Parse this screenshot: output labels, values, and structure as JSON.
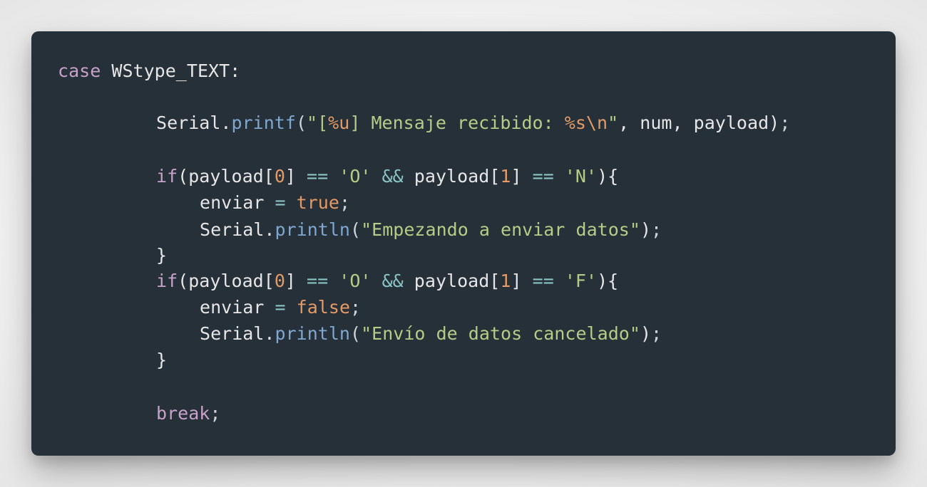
{
  "theme": {
    "background": "#263038",
    "page_background": "#f1f1f1",
    "colors": {
      "plain": "#e6e6e6",
      "keyword": "#c6a1c9",
      "function": "#7fa7cf",
      "string": "#b5cc87",
      "format": "#e39a66",
      "number": "#e39a66",
      "operator": "#8ac4c4",
      "boolean": "#e39a66",
      "punctuation": "#cfd4d8"
    }
  },
  "code": {
    "lines": [
      {
        "indent": 0,
        "tokens": [
          {
            "t": "case",
            "k": "keyword"
          },
          {
            "t": " WStype_TEXT:",
            "k": "plain"
          }
        ]
      },
      {
        "indent": 0,
        "tokens": []
      },
      {
        "indent": 2,
        "tokens": [
          {
            "t": "Serial.",
            "k": "plain"
          },
          {
            "t": "printf",
            "k": "function"
          },
          {
            "t": "(",
            "k": "punctuation"
          },
          {
            "t": "\"",
            "k": "string"
          },
          {
            "t": "[",
            "k": "string"
          },
          {
            "t": "%u",
            "k": "format"
          },
          {
            "t": "] Mensaje recibido: ",
            "k": "string"
          },
          {
            "t": "%s\\n",
            "k": "format"
          },
          {
            "t": "\"",
            "k": "string"
          },
          {
            "t": ", num, payload)",
            "k": "plain"
          },
          {
            "t": ";",
            "k": "punctuation"
          }
        ]
      },
      {
        "indent": 0,
        "tokens": []
      },
      {
        "indent": 2,
        "tokens": [
          {
            "t": "if",
            "k": "keyword"
          },
          {
            "t": "(payload[",
            "k": "plain"
          },
          {
            "t": "0",
            "k": "number"
          },
          {
            "t": "] ",
            "k": "plain"
          },
          {
            "t": "==",
            "k": "operator"
          },
          {
            "t": " ",
            "k": "plain"
          },
          {
            "t": "'O'",
            "k": "string"
          },
          {
            "t": " ",
            "k": "plain"
          },
          {
            "t": "&&",
            "k": "operator"
          },
          {
            "t": " payload[",
            "k": "plain"
          },
          {
            "t": "1",
            "k": "number"
          },
          {
            "t": "] ",
            "k": "plain"
          },
          {
            "t": "==",
            "k": "operator"
          },
          {
            "t": " ",
            "k": "plain"
          },
          {
            "t": "'N'",
            "k": "string"
          },
          {
            "t": "){",
            "k": "plain"
          }
        ]
      },
      {
        "indent": 3,
        "tokens": [
          {
            "t": "enviar ",
            "k": "plain"
          },
          {
            "t": "=",
            "k": "operator"
          },
          {
            "t": " ",
            "k": "plain"
          },
          {
            "t": "true",
            "k": "boolean"
          },
          {
            "t": ";",
            "k": "punctuation"
          }
        ]
      },
      {
        "indent": 3,
        "tokens": [
          {
            "t": "Serial.",
            "k": "plain"
          },
          {
            "t": "println",
            "k": "function"
          },
          {
            "t": "(",
            "k": "punctuation"
          },
          {
            "t": "\"Empezando a enviar datos\"",
            "k": "string"
          },
          {
            "t": ")",
            "k": "plain"
          },
          {
            "t": ";",
            "k": "punctuation"
          }
        ]
      },
      {
        "indent": 2,
        "tokens": [
          {
            "t": "}",
            "k": "plain"
          }
        ]
      },
      {
        "indent": 2,
        "tokens": [
          {
            "t": "if",
            "k": "keyword"
          },
          {
            "t": "(payload[",
            "k": "plain"
          },
          {
            "t": "0",
            "k": "number"
          },
          {
            "t": "] ",
            "k": "plain"
          },
          {
            "t": "==",
            "k": "operator"
          },
          {
            "t": " ",
            "k": "plain"
          },
          {
            "t": "'O'",
            "k": "string"
          },
          {
            "t": " ",
            "k": "plain"
          },
          {
            "t": "&&",
            "k": "operator"
          },
          {
            "t": " payload[",
            "k": "plain"
          },
          {
            "t": "1",
            "k": "number"
          },
          {
            "t": "] ",
            "k": "plain"
          },
          {
            "t": "==",
            "k": "operator"
          },
          {
            "t": " ",
            "k": "plain"
          },
          {
            "t": "'F'",
            "k": "string"
          },
          {
            "t": "){",
            "k": "plain"
          }
        ]
      },
      {
        "indent": 3,
        "tokens": [
          {
            "t": "enviar ",
            "k": "plain"
          },
          {
            "t": "=",
            "k": "operator"
          },
          {
            "t": " ",
            "k": "plain"
          },
          {
            "t": "false",
            "k": "boolean"
          },
          {
            "t": ";",
            "k": "punctuation"
          }
        ]
      },
      {
        "indent": 3,
        "tokens": [
          {
            "t": "Serial.",
            "k": "plain"
          },
          {
            "t": "println",
            "k": "function"
          },
          {
            "t": "(",
            "k": "punctuation"
          },
          {
            "t": "\"Envío de datos cancelado\"",
            "k": "string"
          },
          {
            "t": ")",
            "k": "plain"
          },
          {
            "t": ";",
            "k": "punctuation"
          }
        ]
      },
      {
        "indent": 2,
        "tokens": [
          {
            "t": "}",
            "k": "plain"
          }
        ]
      },
      {
        "indent": 0,
        "tokens": []
      },
      {
        "indent": 2,
        "tokens": [
          {
            "t": "break",
            "k": "keyword"
          },
          {
            "t": ";",
            "k": "punctuation"
          }
        ]
      }
    ]
  }
}
